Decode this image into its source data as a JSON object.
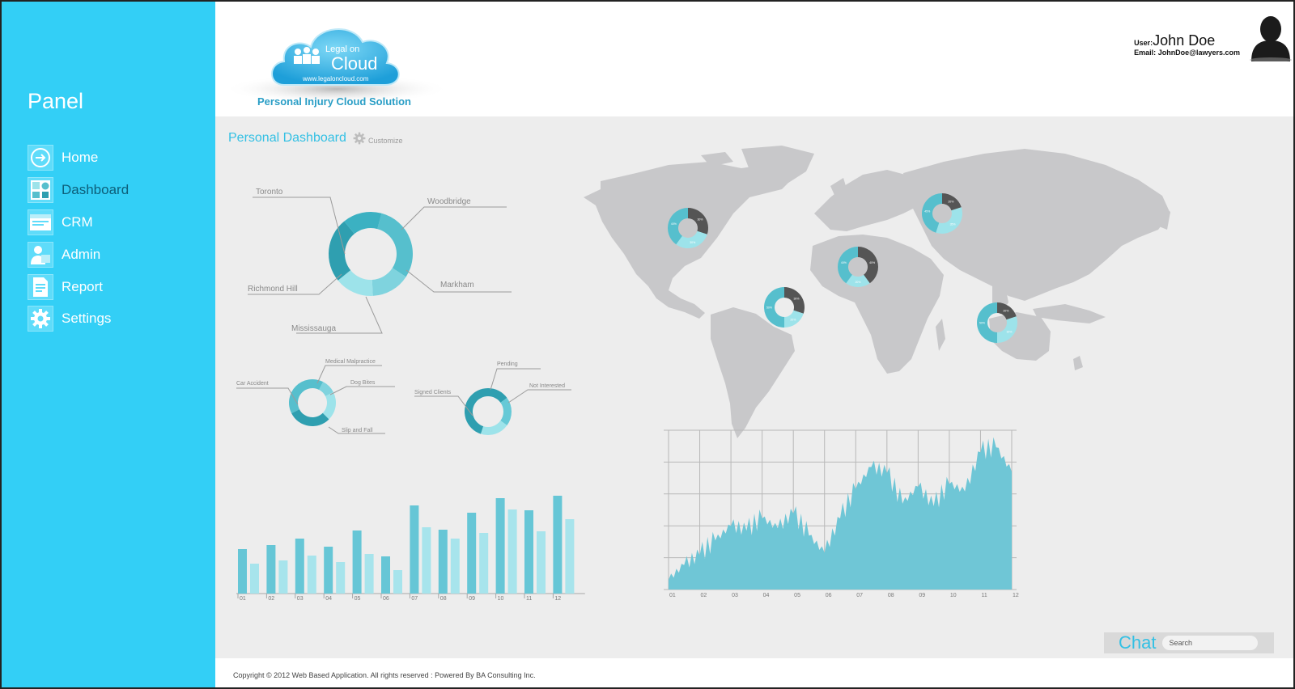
{
  "sidebar": {
    "title": "Panel",
    "items": [
      {
        "label": "Home",
        "icon": "arrow-right-icon"
      },
      {
        "label": "Dashboard",
        "icon": "dashboard-icon"
      },
      {
        "label": "CRM",
        "icon": "crm-window-icon"
      },
      {
        "label": "Admin",
        "icon": "admin-user-icon"
      },
      {
        "label": "Report",
        "icon": "report-document-icon"
      },
      {
        "label": "Settings",
        "icon": "gear-icon"
      }
    ],
    "active_index": 1
  },
  "header": {
    "logo_text": {
      "top": "Legal on",
      "main": "Cloud",
      "url": "www.legaloncloud.com"
    },
    "tagline": "Personal Injury Cloud Solution",
    "user_label": "User:",
    "user_name": "John Doe",
    "email_label": "Email:",
    "email": "JohnDoe@lawyers.com"
  },
  "dashboard": {
    "title": "Personal Dashboard",
    "customize_label": "Customize"
  },
  "chat": {
    "label": "Chat",
    "search_placeholder": "Search"
  },
  "footer": {
    "copyright": "Copyright © 2012 Web Based Application. All rights reserved : Powered By BA Consulting Inc."
  },
  "colors": {
    "sidebar": "#33cff6",
    "accent": "#33c0e4",
    "teal_dark": "#2f9fb0",
    "teal_mid": "#56bfcd",
    "teal_light": "#9de3ea",
    "map_gray": "#c8c8ca",
    "dark_segment": "#555555"
  },
  "chart_data": [
    {
      "type": "pie",
      "title": "",
      "variant": "donut",
      "categories": [
        "Toronto",
        "Woodbridge",
        "Markham",
        "Mississauga",
        "Richmond Hill"
      ],
      "values": [
        30,
        15,
        15,
        25,
        15
      ]
    },
    {
      "type": "pie",
      "title": "",
      "variant": "donut",
      "categories": [
        "Car Accident",
        "Medical Malpractice",
        "Dog Bites",
        "Slip and Fall"
      ],
      "values": [
        40,
        10,
        20,
        30
      ]
    },
    {
      "type": "pie",
      "title": "",
      "variant": "donut",
      "categories": [
        "Signed Clients",
        "Pending",
        "Not Interested"
      ],
      "values": [
        60,
        20,
        20
      ]
    },
    {
      "type": "bar",
      "title": "",
      "categories": [
        "01",
        "02",
        "03",
        "04",
        "05",
        "06",
        "07",
        "08",
        "09",
        "10",
        "11",
        "12"
      ],
      "series": [
        {
          "values": [
            55,
            60,
            68,
            58,
            78,
            46,
            109,
            79,
            100,
            118,
            103,
            121
          ]
        },
        {
          "values": [
            37,
            41,
            47,
            39,
            49,
            29,
            82,
            68,
            75,
            104,
            77,
            92
          ]
        }
      ],
      "ylim": [
        0,
        130
      ]
    },
    {
      "type": "area",
      "title": "",
      "categories": [
        "01",
        "02",
        "03",
        "04",
        "05",
        "06",
        "07",
        "08",
        "09",
        "10",
        "11",
        "12"
      ],
      "x": [
        1,
        1.5,
        2,
        2.5,
        3,
        3.5,
        4,
        4.5,
        5,
        5.5,
        6,
        6.5,
        7,
        7.5,
        8,
        8.5,
        9,
        9.5,
        10,
        10.5,
        11,
        11.5,
        12
      ],
      "values": [
        8,
        20,
        28,
        40,
        52,
        48,
        58,
        50,
        62,
        44,
        30,
        58,
        82,
        100,
        95,
        70,
        84,
        68,
        86,
        80,
        112,
        116,
        96
      ],
      "ylim": [
        0,
        130
      ],
      "grid": true
    },
    {
      "type": "pie",
      "title": "",
      "variant": "map-donut",
      "region": "North America",
      "values": [
        30,
        30,
        40
      ],
      "data_labels": [
        "30%",
        "30%",
        "40%"
      ]
    },
    {
      "type": "pie",
      "title": "",
      "variant": "map-donut",
      "region": "Russia",
      "values": [
        20,
        35,
        45
      ],
      "data_labels": [
        "20%",
        "35%",
        "45%"
      ]
    },
    {
      "type": "pie",
      "title": "",
      "variant": "map-donut",
      "region": "Africa",
      "values": [
        40,
        20,
        40
      ],
      "data_labels": [
        "40%",
        "20%",
        "40%"
      ]
    },
    {
      "type": "pie",
      "title": "",
      "variant": "map-donut",
      "region": "South America",
      "values": [
        30,
        20,
        50
      ],
      "data_labels": [
        "30%",
        "20%",
        "50%"
      ]
    },
    {
      "type": "pie",
      "title": "",
      "variant": "map-donut",
      "region": "Australia",
      "values": [
        20,
        30,
        50
      ],
      "data_labels": [
        "20%",
        "30%",
        "50%"
      ]
    }
  ]
}
